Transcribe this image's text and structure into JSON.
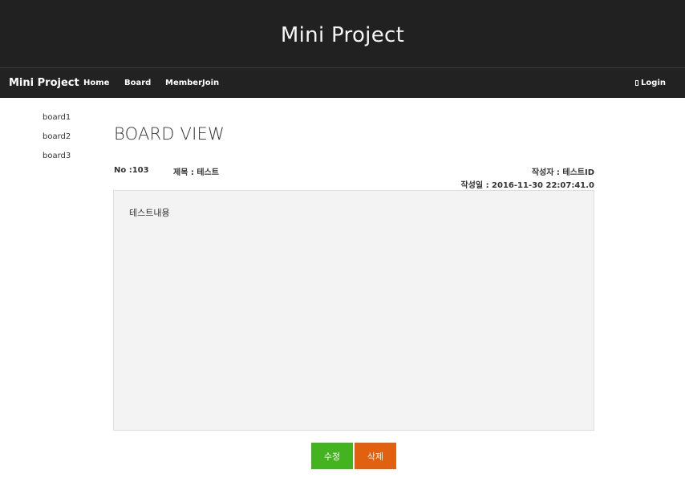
{
  "banner": {
    "title": "Mini Project"
  },
  "navbar": {
    "brand": "Mini Project",
    "links": [
      "Home",
      "Board",
      "MemberJoin"
    ],
    "login": "Login"
  },
  "sidebar": {
    "items": [
      "board1",
      "board2",
      "board3"
    ]
  },
  "main": {
    "title": "BOARD VIEW",
    "no": "No :103",
    "subject": "제목 : 테스트",
    "author": "작성자 : 테스트ID",
    "date": "작성일 : 2016-11-30 22:07:41.0",
    "content": "테스트내용"
  },
  "buttons": {
    "edit": "수정",
    "delete": "삭제"
  },
  "colors": {
    "banner_bg": "#212121",
    "navbar_bg": "#222222",
    "edit_button": "#43b41f",
    "delete_button": "#e26111",
    "content_bg": "#f3f3f3"
  },
  "icons": {
    "login": "login-icon"
  }
}
